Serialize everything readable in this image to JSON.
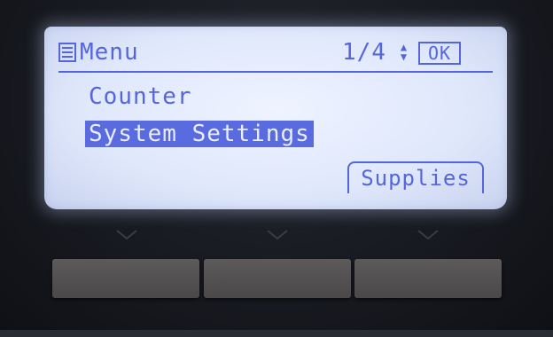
{
  "screen": {
    "title": "Menu",
    "page_indicator": "1/4",
    "ok_label": "OK",
    "items": [
      {
        "label": "Counter",
        "selected": false
      },
      {
        "label": "System Settings",
        "selected": true
      }
    ],
    "softkey_label": "Supplies"
  },
  "icons": {
    "menu": "menu-list-icon",
    "updown": "up-down-arrows-icon",
    "chevron": "chevron-down-icon"
  },
  "colors": {
    "lcd_background": "#dfe7fb",
    "lcd_text": "#5566dd",
    "selection_background": "#5a6be0",
    "hardware_button": "#545252"
  }
}
